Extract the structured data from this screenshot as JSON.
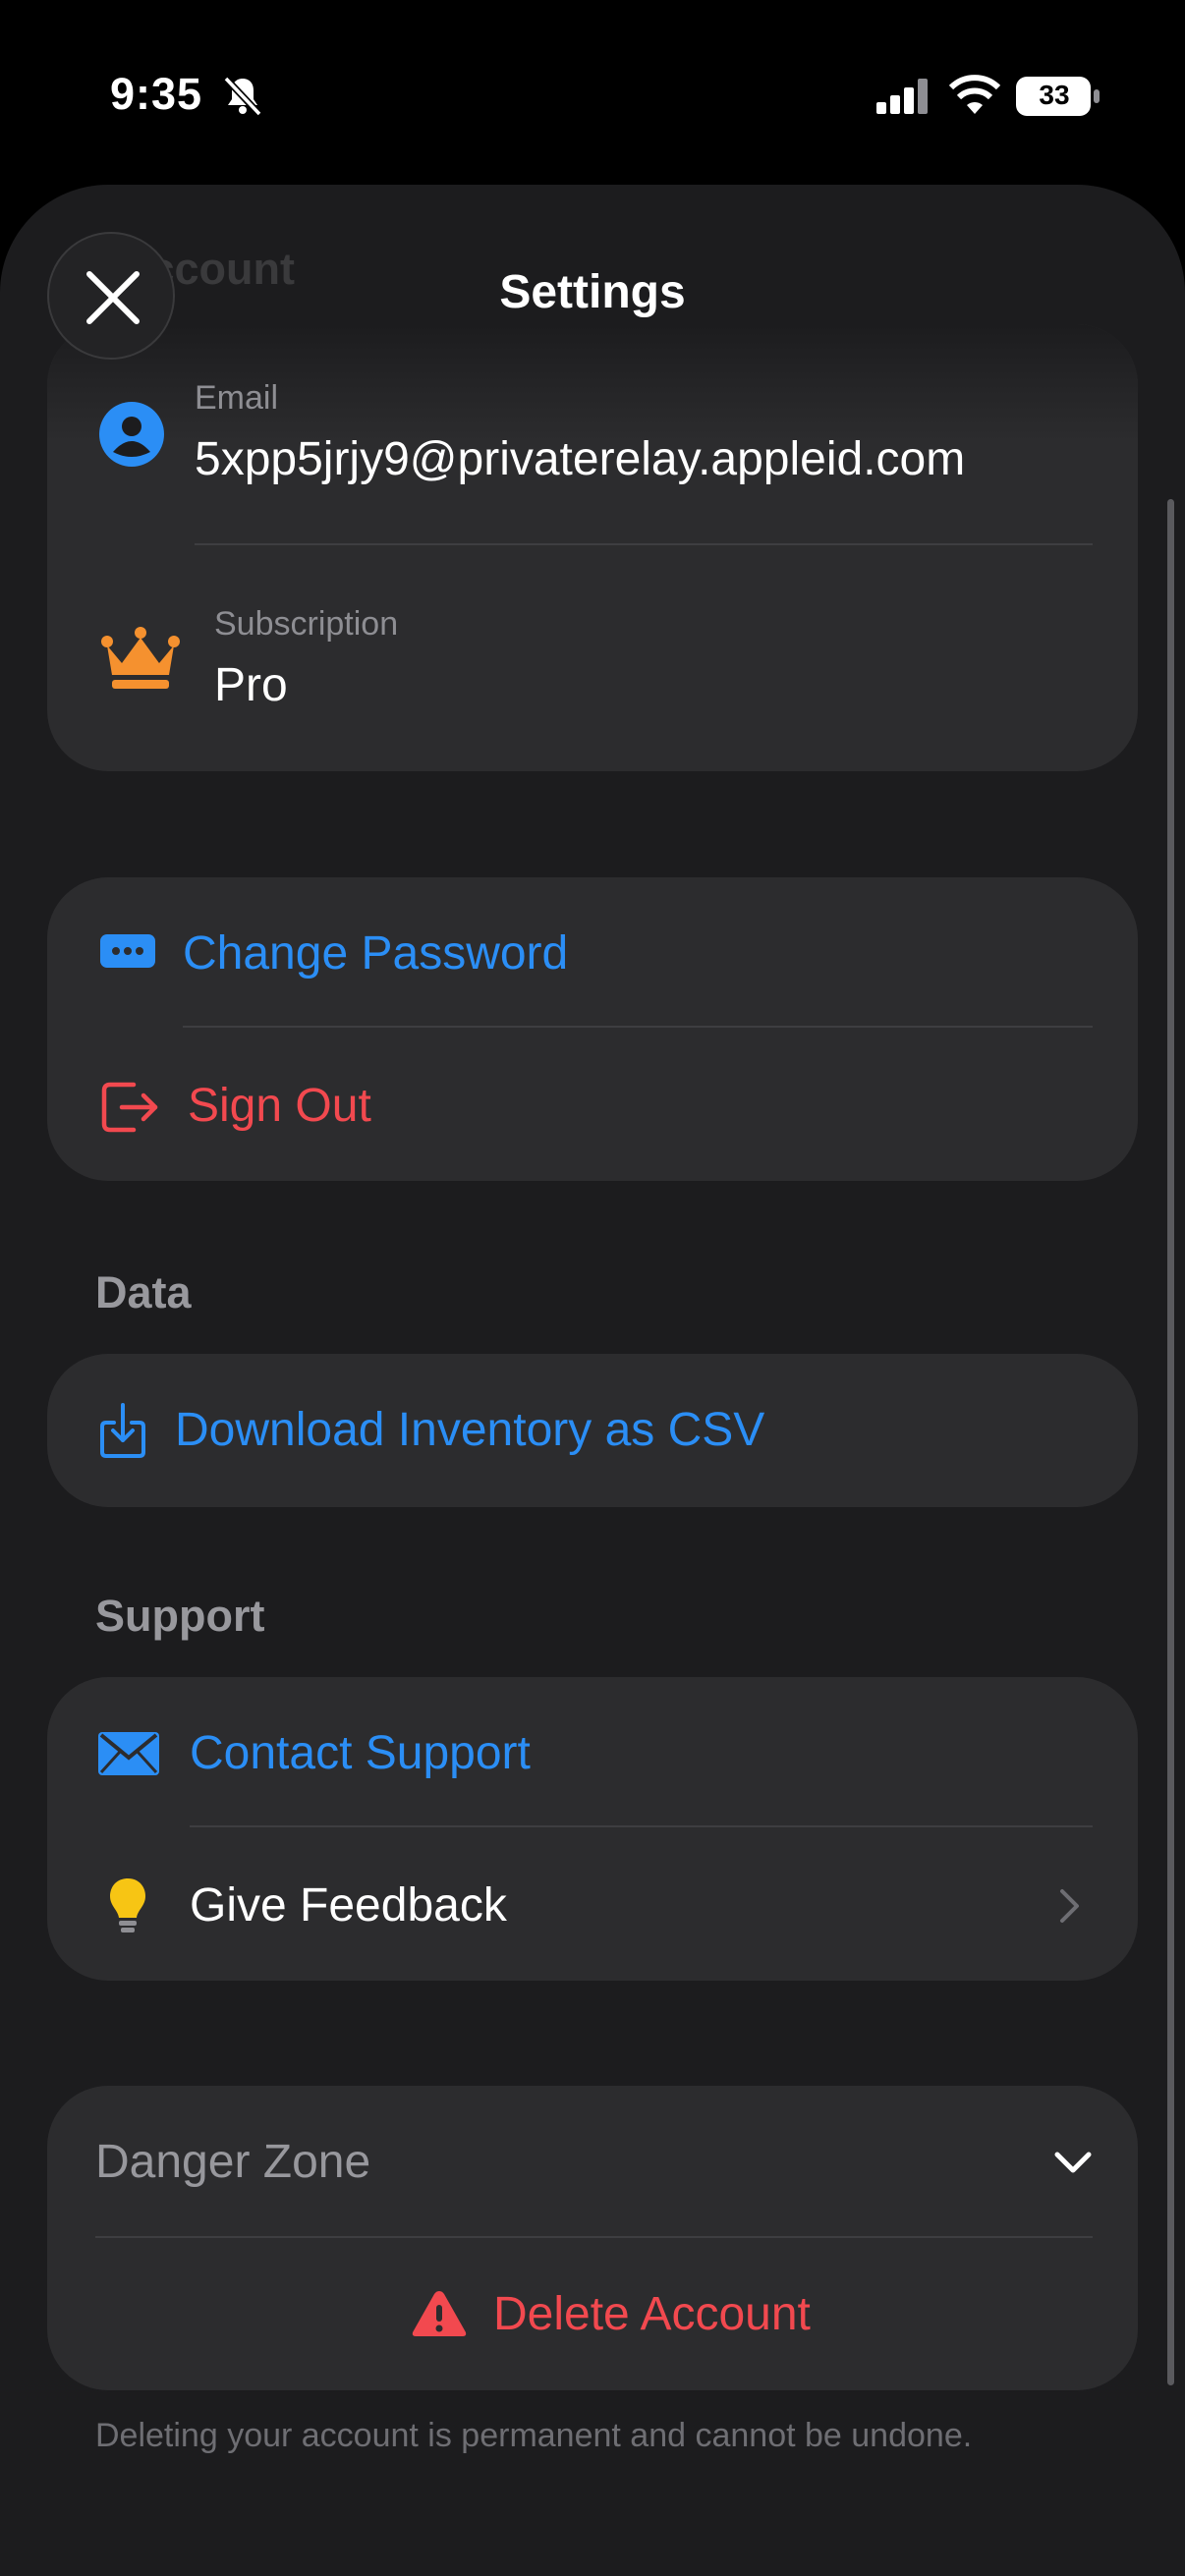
{
  "status_bar": {
    "time": "9:35",
    "battery": "33"
  },
  "header": {
    "title": "Settings",
    "ghost_text": "Account"
  },
  "account": {
    "email_label": "Email",
    "email_value": "5xpp5jrjy9@privaterelay.appleid.com",
    "subscription_label": "Subscription",
    "subscription_value": "Pro"
  },
  "auth_actions": {
    "change_password": "Change Password",
    "sign_out": "Sign Out"
  },
  "data_section": {
    "header": "Data",
    "download_csv": "Download Inventory as CSV"
  },
  "support_section": {
    "header": "Support",
    "contact_support": "Contact Support",
    "give_feedback": "Give Feedback"
  },
  "danger_zone": {
    "title": "Danger Zone",
    "delete_account": "Delete Account",
    "footnote": "Deleting your account is permanent and cannot be undone."
  },
  "colors": {
    "accent_blue": "#2b8ef5",
    "destructive_red": "#f2494f",
    "crown_orange": "#f5912f",
    "bulb_yellow": "#f7c514"
  }
}
